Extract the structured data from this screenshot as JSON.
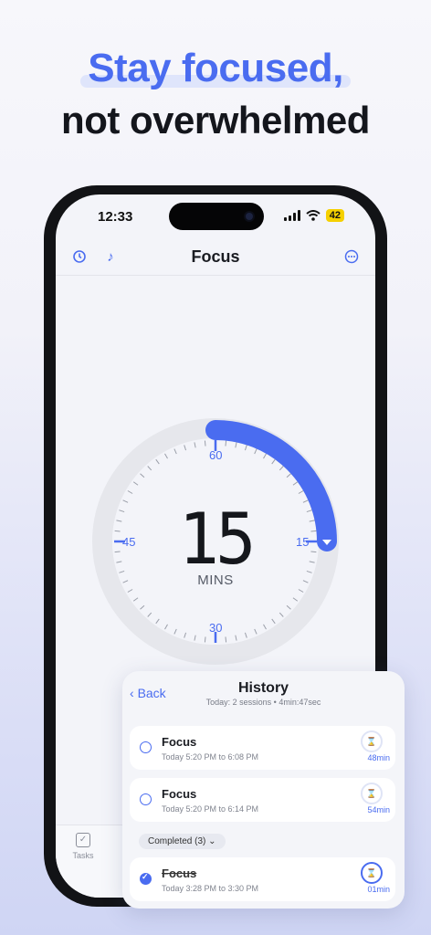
{
  "headline": {
    "line1": "Stay focused,",
    "line2": "not overwhelmed"
  },
  "status_bar": {
    "time": "12:33",
    "battery": "42"
  },
  "topbar": {
    "title": "Focus",
    "left_icons": [
      "timer-icon",
      "music-note-icon"
    ],
    "right_icon": "more-icon"
  },
  "timer": {
    "digits": "15",
    "unit": "MINS",
    "labels": {
      "top": "60",
      "right": "15",
      "bottom": "30",
      "left": "45"
    },
    "progress_fraction": 0.25,
    "accent": "#4a6cf0"
  },
  "tabbar": {
    "tab_label": "Tasks"
  },
  "history": {
    "back_label": "Back",
    "title": "History",
    "subtitle": "Today: 2 sessions • 4min:47sec",
    "sessions": [
      {
        "name": "Focus",
        "time": "Today 5:20 PM to 6:08 PM",
        "duration": "48min"
      },
      {
        "name": "Focus",
        "time": "Today 5:20 PM to 6:14 PM",
        "duration": "54min"
      }
    ],
    "completed_label": "Completed (3)",
    "completed": [
      {
        "name": "Focus",
        "time": "Today 3:28 PM to 3:30 PM",
        "duration": "01min"
      }
    ]
  }
}
